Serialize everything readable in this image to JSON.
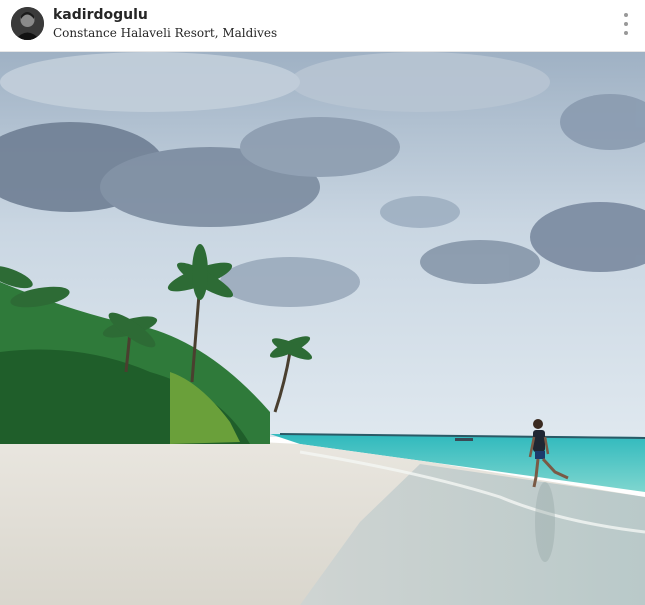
{
  "post": {
    "username": "kadirdogulu",
    "location": "Constance Halaveli Resort, Maldives"
  },
  "icons": {
    "avatar": "user-avatar",
    "more": "more-options-icon"
  },
  "photo": {
    "subject": "beach-photo"
  }
}
